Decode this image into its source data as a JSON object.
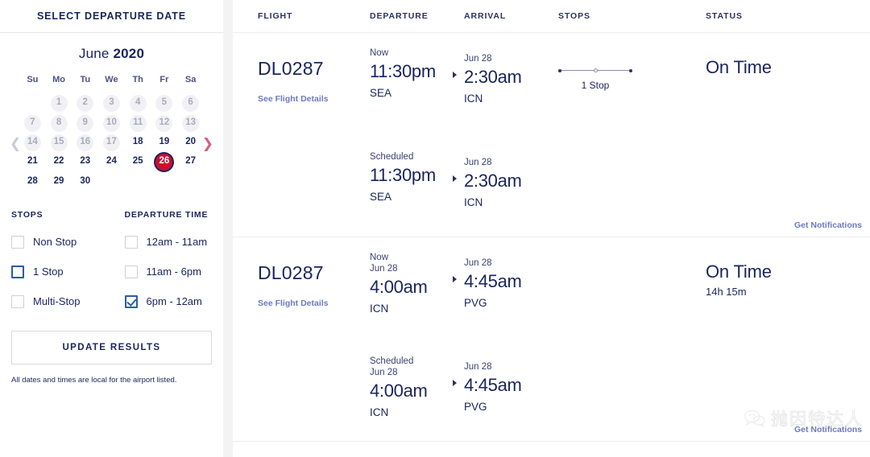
{
  "sidebar": {
    "header_title": "SELECT DEPARTURE DATE",
    "calendar": {
      "month": "June",
      "year": "2020",
      "prev_icon": "chevron-left-icon",
      "next_icon": "chevron-right-icon",
      "weekdays": [
        "Su",
        "Mo",
        "Tu",
        "We",
        "Th",
        "Fr",
        "Sa"
      ],
      "weeks": [
        [
          {
            "label": "",
            "state": "empty"
          },
          {
            "label": "1",
            "state": "disabled"
          },
          {
            "label": "2",
            "state": "disabled"
          },
          {
            "label": "3",
            "state": "disabled"
          },
          {
            "label": "4",
            "state": "disabled"
          },
          {
            "label": "5",
            "state": "disabled"
          },
          {
            "label": "6",
            "state": "disabled"
          }
        ],
        [
          {
            "label": "7",
            "state": "disabled"
          },
          {
            "label": "8",
            "state": "disabled"
          },
          {
            "label": "9",
            "state": "disabled"
          },
          {
            "label": "10",
            "state": "disabled"
          },
          {
            "label": "11",
            "state": "disabled"
          },
          {
            "label": "12",
            "state": "disabled"
          },
          {
            "label": "13",
            "state": "disabled"
          }
        ],
        [
          {
            "label": "14",
            "state": "disabled"
          },
          {
            "label": "15",
            "state": "disabled"
          },
          {
            "label": "16",
            "state": "disabled"
          },
          {
            "label": "17",
            "state": "disabled"
          },
          {
            "label": "18",
            "state": "enabled"
          },
          {
            "label": "19",
            "state": "enabled"
          },
          {
            "label": "20",
            "state": "enabled"
          }
        ],
        [
          {
            "label": "21",
            "state": "enabled"
          },
          {
            "label": "22",
            "state": "enabled"
          },
          {
            "label": "23",
            "state": "enabled"
          },
          {
            "label": "24",
            "state": "enabled"
          },
          {
            "label": "25",
            "state": "enabled"
          },
          {
            "label": "26",
            "state": "selected"
          },
          {
            "label": "27",
            "state": "enabled"
          }
        ],
        [
          {
            "label": "28",
            "state": "enabled"
          },
          {
            "label": "29",
            "state": "enabled"
          },
          {
            "label": "30",
            "state": "enabled"
          },
          {
            "label": "",
            "state": "empty"
          },
          {
            "label": "",
            "state": "empty"
          },
          {
            "label": "",
            "state": "empty"
          },
          {
            "label": "",
            "state": "empty"
          }
        ]
      ]
    },
    "filters": {
      "stops": {
        "title": "STOPS",
        "options": [
          {
            "label": "Non Stop",
            "state": "unchecked"
          },
          {
            "label": "1 Stop",
            "state": "focused"
          },
          {
            "label": "Multi-Stop",
            "state": "unchecked"
          }
        ]
      },
      "departure_time": {
        "title": "DEPARTURE TIME",
        "options": [
          {
            "label": "12am - 11am",
            "state": "unchecked"
          },
          {
            "label": "11am - 6pm",
            "state": "unchecked"
          },
          {
            "label": "6pm - 12am",
            "state": "checked"
          }
        ]
      }
    },
    "update_button": "UPDATE RESULTS",
    "disclaimer": "All dates and times are local for the airport listed."
  },
  "results": {
    "columns": {
      "flight": "FLIGHT",
      "departure": "DEPARTURE",
      "arrival": "ARRIVAL",
      "stops": "STOPS",
      "status": "STATUS"
    },
    "rows": [
      {
        "kind": "primary",
        "flight_no": "DL0287",
        "details_link": "See Flight Details",
        "departure": {
          "meta": "Now",
          "meta2": "",
          "time": "11:30pm",
          "airport": "SEA"
        },
        "arrival": {
          "meta": "Jun 28",
          "time": "2:30am",
          "airport": "ICN"
        },
        "stops": {
          "label": "1 Stop",
          "count": 1
        },
        "status": {
          "text": "On Time",
          "sub": ""
        }
      },
      {
        "kind": "secondary",
        "departure": {
          "meta": "Scheduled",
          "meta2": "",
          "time": "11:30pm",
          "airport": "SEA"
        },
        "arrival": {
          "meta": "Jun 28",
          "time": "2:30am",
          "airport": "ICN"
        },
        "notify_link": "Get Notifications"
      },
      {
        "kind": "primary",
        "flight_no": "DL0287",
        "details_link": "See Flight Details",
        "departure": {
          "meta": "Now",
          "meta2": "Jun 28",
          "time": "4:00am",
          "airport": "ICN"
        },
        "arrival": {
          "meta": "Jun 28",
          "time": "4:45am",
          "airport": "PVG"
        },
        "stops": null,
        "status": {
          "text": "On Time",
          "sub": "14h 15m"
        }
      },
      {
        "kind": "secondary",
        "departure": {
          "meta": "Scheduled",
          "meta2": "Jun 28",
          "time": "4:00am",
          "airport": "ICN"
        },
        "arrival": {
          "meta": "Jun 28",
          "time": "4:45am",
          "airport": "PVG"
        },
        "notify_link": "Get Notifications"
      }
    ]
  },
  "watermark": {
    "text": "抛因特达人",
    "logo": "wechat-icon"
  },
  "colors": {
    "navy": "#19245c",
    "selected_red": "#c8102e",
    "link_blue": "#6c7ac0",
    "checkbox_blue": "#2a5caa",
    "next_arrow_pink": "#d0607c"
  }
}
